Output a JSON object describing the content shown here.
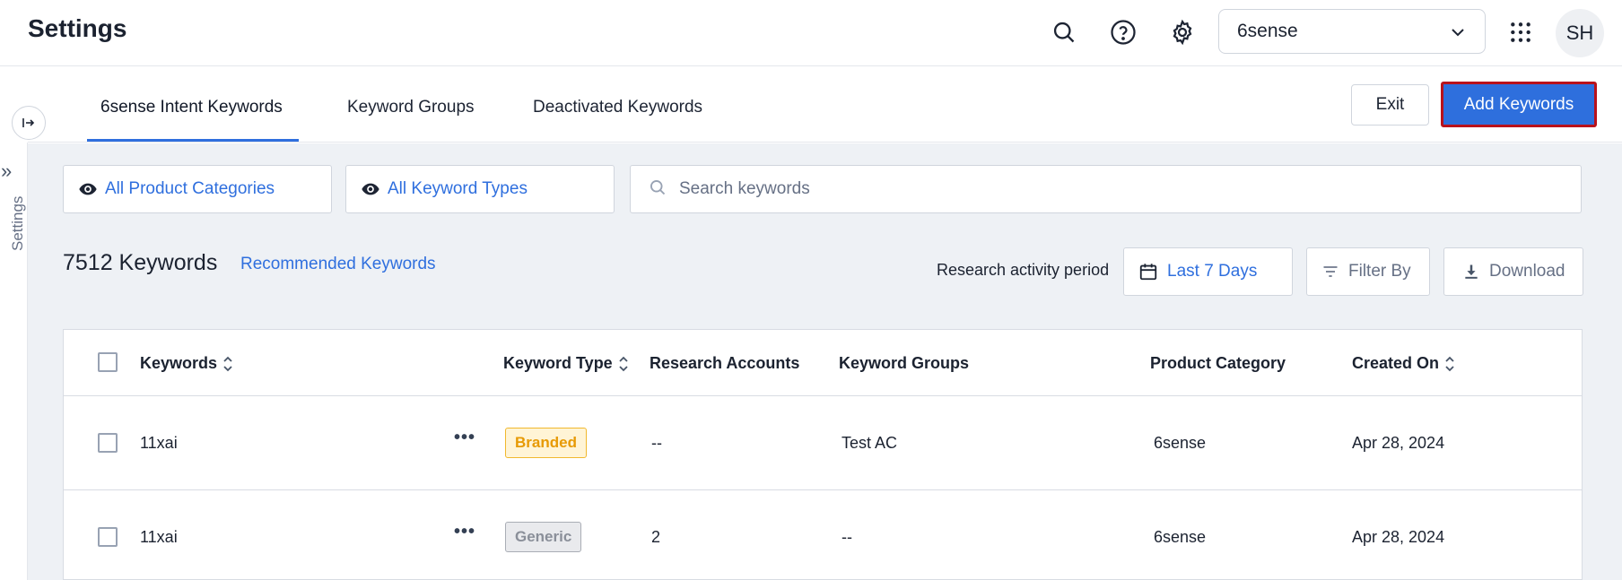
{
  "header": {
    "title": "Settings",
    "org_select": "6sense",
    "avatar_initials": "SH",
    "icons": [
      "search-icon",
      "help-icon",
      "gear-icon",
      "apps-grid-icon"
    ]
  },
  "rail": {
    "label": "Settings"
  },
  "tabs": [
    {
      "label": "6sense Intent Keywords",
      "active": true
    },
    {
      "label": "Keyword Groups",
      "active": false
    },
    {
      "label": "Deactivated Keywords",
      "active": false
    }
  ],
  "actions": {
    "exit": "Exit",
    "add": "Add Keywords"
  },
  "filters": {
    "product_categories": "All Product Categories",
    "keyword_types": "All Keyword Types",
    "search_placeholder": "Search keywords"
  },
  "summary": {
    "count": "7512 Keywords",
    "recommended": "Recommended Keywords",
    "period_label": "Research activity period",
    "period_value": "Last 7 Days",
    "filter_by": "Filter By",
    "download": "Download"
  },
  "table": {
    "columns": [
      "Keywords",
      "Keyword Type",
      "Research Accounts",
      "Keyword Groups",
      "Product Category",
      "Created On"
    ],
    "rows": [
      {
        "keyword": "11xai",
        "type": "Branded",
        "accounts": "--",
        "groups": "Test AC",
        "category": "6sense",
        "created": "Apr 28, 2024"
      },
      {
        "keyword": "11xai",
        "type": "Generic",
        "accounts": "2",
        "groups": "--",
        "category": "6sense",
        "created": "Apr 28, 2024"
      }
    ]
  },
  "colors": {
    "accent": "#2f6fde",
    "primary_button": "#2e6fdd",
    "highlight_border": "#b8121c",
    "branded_badge": "#fff4d6",
    "generic_badge": "#e9eaed"
  }
}
